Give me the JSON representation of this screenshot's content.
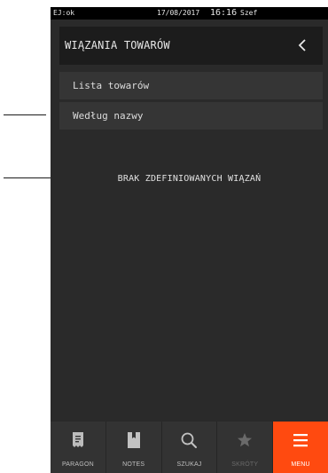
{
  "status_bar": {
    "left": "EJ:ok",
    "date": "17/08/2017",
    "time": "16:16",
    "user": "Szef"
  },
  "header": {
    "title": "WIĄZANIA TOWARÓW",
    "back_icon": "chevron-left-icon"
  },
  "menu": {
    "items": [
      {
        "label": "Lista towarów"
      },
      {
        "label": "Według nazwy"
      }
    ]
  },
  "main": {
    "empty_message": "BRAK ZDEFINIOWANYCH WIĄZAŃ"
  },
  "bottom_nav": {
    "buttons": [
      {
        "label": "PARAGON",
        "icon": "receipt-icon",
        "state": "normal"
      },
      {
        "label": "NOTES",
        "icon": "notebook-icon",
        "state": "normal"
      },
      {
        "label": "SZUKAJ",
        "icon": "search-icon",
        "state": "normal"
      },
      {
        "label": "SKRÓTY",
        "icon": "star-icon",
        "state": "disabled"
      },
      {
        "label": "MENU",
        "icon": "hamburger-menu-icon",
        "state": "active"
      }
    ]
  },
  "colors": {
    "accent": "#ff4a10",
    "background": "#2a2a2a",
    "header_bg": "#1c1c1c",
    "item_bg": "#353535",
    "nav_bg": "#333333"
  }
}
